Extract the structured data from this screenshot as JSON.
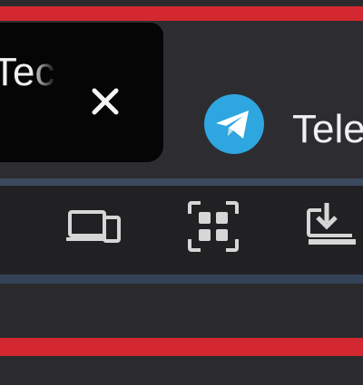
{
  "tabs": [
    {
      "title": "Tech",
      "active": true,
      "close_icon": "close-icon"
    },
    {
      "title": "Telegram",
      "active": false,
      "favicon": "telegram-icon"
    }
  ],
  "toolbar": {
    "buttons": [
      {
        "name": "send-to-devices",
        "icon": "devices-icon"
      },
      {
        "name": "qr-code",
        "icon": "qr-code-icon"
      },
      {
        "name": "install-app",
        "icon": "install-icon"
      }
    ]
  },
  "colors": {
    "accent_red": "#d3282f",
    "telegram_blue": "#2ea6e0",
    "tab_active_bg": "#050506",
    "toolbar_bg": "#212124"
  }
}
